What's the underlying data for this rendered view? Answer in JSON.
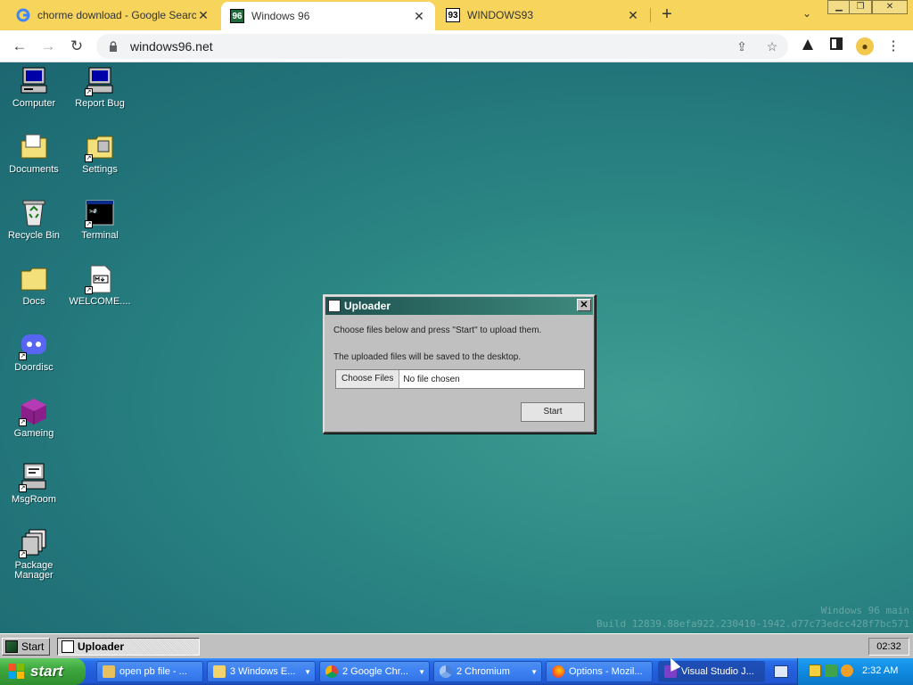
{
  "browser": {
    "tabs": [
      {
        "title": "chorme download - Google Search",
        "favicon": "google-icon"
      },
      {
        "title": "Windows 96",
        "favicon": "windows96-icon"
      },
      {
        "title": "WINDOWS93",
        "favicon": "windows93-icon"
      }
    ],
    "url": "windows96.net",
    "new_tab_label": "+"
  },
  "desktop": {
    "icons": [
      {
        "label": "Computer",
        "icon": "computer-icon"
      },
      {
        "label": "Report Bug",
        "icon": "report-bug-icon"
      },
      {
        "label": "Documents",
        "icon": "documents-folder-icon"
      },
      {
        "label": "Settings",
        "icon": "settings-folder-icon"
      },
      {
        "label": "Recycle Bin",
        "icon": "recycle-bin-icon"
      },
      {
        "label": "Terminal",
        "icon": "terminal-icon"
      },
      {
        "label": "Docs",
        "icon": "folder-icon"
      },
      {
        "label": "WELCOME....",
        "icon": "markdown-file-icon"
      },
      {
        "label": "Doordisc",
        "icon": "discord-icon"
      },
      {
        "label": "Gameing",
        "icon": "game-cube-icon"
      },
      {
        "label": "MsgRoom",
        "icon": "msgroom-icon"
      },
      {
        "label": "Package Manager",
        "icon": "package-manager-icon"
      }
    ],
    "watermark_line1": "Windows 96 main",
    "watermark_line2": "Build 12839.88efa922.230410-1942.d77c73edcc428f7bc571"
  },
  "uploader": {
    "title": "Uploader",
    "instruction": "Choose files below and press \"Start\" to upload them.",
    "note": "The uploaded files will be saved to the desktop.",
    "choose_files_label": "Choose Files",
    "file_status": "No file chosen",
    "start_label": "Start"
  },
  "w96_taskbar": {
    "start_label": "Start",
    "active_task": "Uploader",
    "clock": "02:32"
  },
  "xp_taskbar": {
    "start_label": "start",
    "tasks": [
      {
        "label": "open pb file - ...",
        "icon": "explorer-icon"
      },
      {
        "label": "3 Windows E...",
        "icon": "folder-icon"
      },
      {
        "label": "2 Google Chr...",
        "icon": "chrome-icon"
      },
      {
        "label": "2 Chromium",
        "icon": "chromium-icon"
      },
      {
        "label": "Options - Mozil...",
        "icon": "firefox-icon"
      },
      {
        "label": "Visual Studio J...",
        "icon": "visual-studio-icon"
      }
    ],
    "clock": "2:32 AM"
  }
}
